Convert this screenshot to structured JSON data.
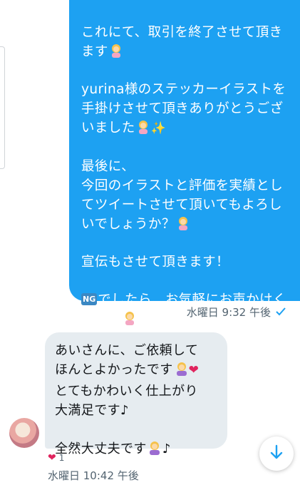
{
  "sent_message": {
    "paragraphs": [
      {
        "text": "これにて、取引を終了させて頂きます",
        "emoji": [
          "woman-gesturing-ok-icon"
        ]
      },
      {
        "text": "yurina様のステッカーイラストを手掛けさせて頂きありがとうございました",
        "emoji": [
          "woman-gesturing-ok-icon",
          "sparkles-icon"
        ]
      },
      {
        "text": "最後に、",
        "emoji": []
      },
      {
        "text": "今回のイラストと評価を実績としてツイートさせて頂いてもよろしいでしょうか？",
        "emoji": [
          "woman-gesturing-ok-icon"
        ]
      },
      {
        "text": "宣伝もさせて頂きます！",
        "emoji": []
      },
      {
        "text": "でしたら、お気軽にお声かけください",
        "prefix_badge": "NG",
        "emoji": [
          "woman-gesturing-ok-icon"
        ]
      }
    ],
    "timestamp": "水曜日 9:32 午後",
    "status_icon": "read-check-icon"
  },
  "received_message": {
    "lines": [
      "あいさんに、ご依頼して",
      "ほんとよかったです",
      "とてもかわいく仕上がり",
      "大満足です♪",
      "",
      "全然大丈夫です",
      "♪"
    ],
    "reaction": {
      "icon": "heart-icon",
      "count": "1"
    },
    "timestamp": "水曜日 10:42 午後"
  },
  "colors": {
    "outgoing_bubble": "#1da1f2",
    "incoming_bubble": "#e6ecf0",
    "meta_text": "#536471"
  }
}
